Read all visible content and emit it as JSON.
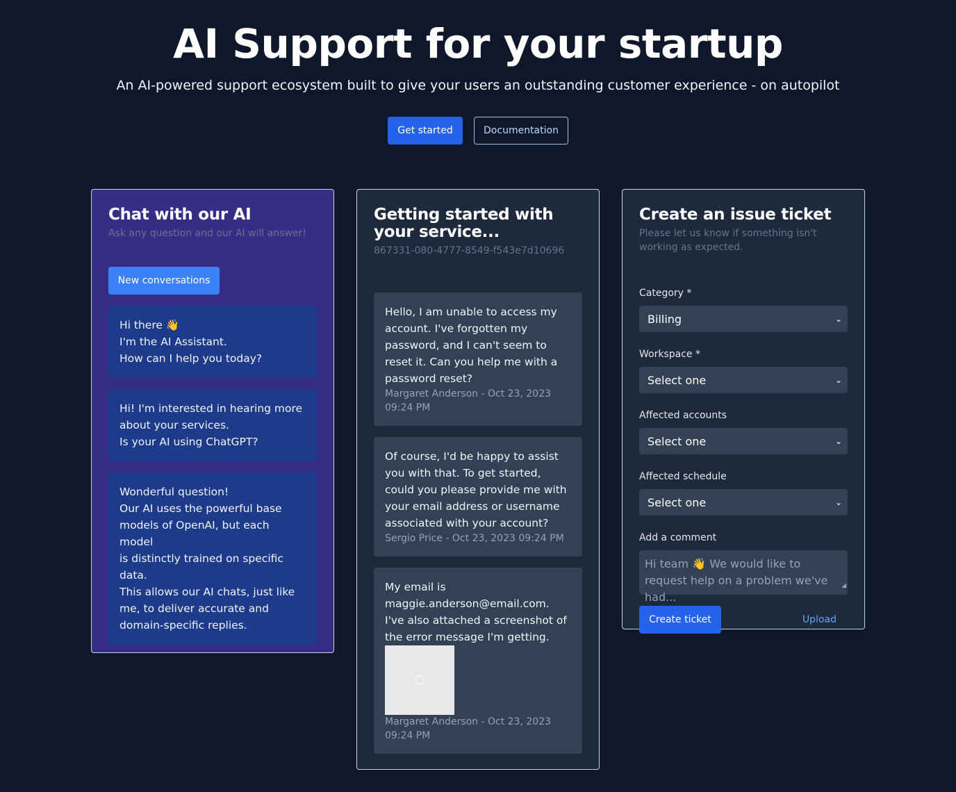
{
  "hero": {
    "title": "AI Support for your startup",
    "subtitle": "An AI-powered support ecosystem built to give your users an outstanding customer experience - on autopilot",
    "primary_button": "Get started",
    "secondary_button": "Documentation"
  },
  "chat": {
    "title": "Chat with our AI",
    "subtitle": "Ask any question and our AI will answer!",
    "new_button": "New conversations",
    "messages": [
      {
        "lines": [
          "Hi there 👋",
          "I'm the AI Assistant.",
          "How can I help you today?"
        ]
      },
      {
        "lines": [
          "Hi! I'm interested in hearing more",
          "about your services.",
          "Is your AI using ChatGPT?"
        ]
      },
      {
        "lines": [
          "Wonderful question!",
          "Our AI uses the powerful base",
          "models of OpenAI, but each model",
          "is distinctly trained on specific",
          "data.",
          "This allows our AI chats, just like",
          "me, to deliver accurate and",
          "domain-specific replies."
        ]
      }
    ]
  },
  "conversation": {
    "title": "Getting started with your service...",
    "id": "867331-080-4777-8549-f543e7d10696",
    "messages": [
      {
        "text": "Hello, I am unable to access my account. I've forgotten my password, and I can't seem to reset it. Can you help me with a password reset?",
        "meta": "Margaret Anderson - Oct 23, 2023 09:24 PM"
      },
      {
        "text": "Of course, I'd be happy to assist you with that. To get started, could you please provide me with your email address or username associated with your account?",
        "meta": "Sergio Price - Oct 23, 2023 09:24 PM"
      },
      {
        "text": "My email is maggie.anderson@email.com. I've also attached a screenshot of the error message I'm getting.",
        "meta": "Margaret Anderson - Oct 23, 2023 09:24 PM"
      }
    ]
  },
  "ticket": {
    "title": "Create an issue ticket",
    "subtitle": "Please let us know if something isn't working as expected.",
    "fields": [
      {
        "label": "Category *",
        "value": "Billing"
      },
      {
        "label": "Workspace *",
        "value": "Select one"
      },
      {
        "label": "Affected accounts",
        "value": "Select one"
      },
      {
        "label": "Affected schedule",
        "value": "Select one"
      }
    ],
    "comment_label": "Add a comment",
    "comment_placeholder": "Hi team 👋 We would like to request help on a problem we've had...",
    "submit_button": "Create ticket",
    "upload_link": "Upload"
  },
  "colors": {
    "background": "#0f172a",
    "primary": "#2563eb",
    "chat_card": "#372d87",
    "chat_bubble": "#1e3a8a",
    "panel": "#1e293b",
    "bubble": "#334155"
  },
  "icons": {
    "select_chevron": "chevron-down-icon",
    "image_placeholder": "image-placeholder-icon"
  }
}
